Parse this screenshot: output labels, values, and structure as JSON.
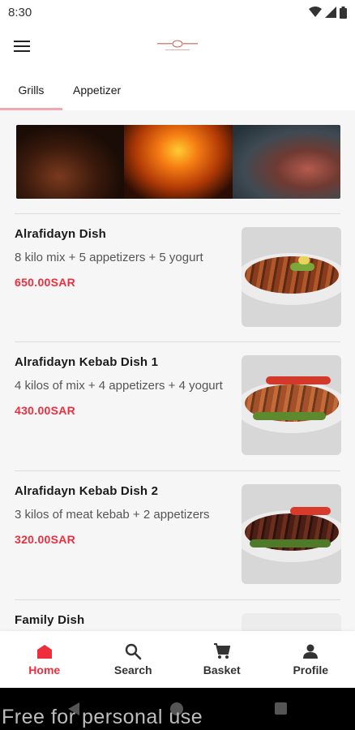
{
  "status_bar": {
    "time": "8:30",
    "icons": [
      "wifi-icon",
      "signal-icon",
      "battery-icon"
    ]
  },
  "app_bar": {
    "menu_icon": "hamburger-menu-icon",
    "logo": "restaurant-logo"
  },
  "tabs": [
    {
      "label": "Grills",
      "active": true
    },
    {
      "label": "Appetizer",
      "active": false
    }
  ],
  "items": [
    {
      "title": "Alrafidayn Dish",
      "description": "8 kilo mix + 5 appetizers + 5 yogurt",
      "price": "650.00SAR"
    },
    {
      "title": "Alrafidayn Kebab Dish 1",
      "description": "4 kilos of mix + 4 appetizers + 4 yogurt",
      "price": "430.00SAR"
    },
    {
      "title": "Alrafidayn Kebab Dish 2",
      "description": "3 kilos of meat kebab + 2 appetizers",
      "price": "320.00SAR"
    },
    {
      "title": "Family Dish",
      "description": "",
      "price": ""
    }
  ],
  "bottom_nav": [
    {
      "label": "Home",
      "icon": "home-icon",
      "active": true
    },
    {
      "label": "Search",
      "icon": "search-icon",
      "active": false
    },
    {
      "label": "Basket",
      "icon": "cart-icon",
      "active": false
    },
    {
      "label": "Profile",
      "icon": "person-icon",
      "active": false
    }
  ],
  "watermark": "Free for personal use",
  "colors": {
    "accent": "#ee2e3d",
    "tab_indicator": "#f2a8b3"
  }
}
